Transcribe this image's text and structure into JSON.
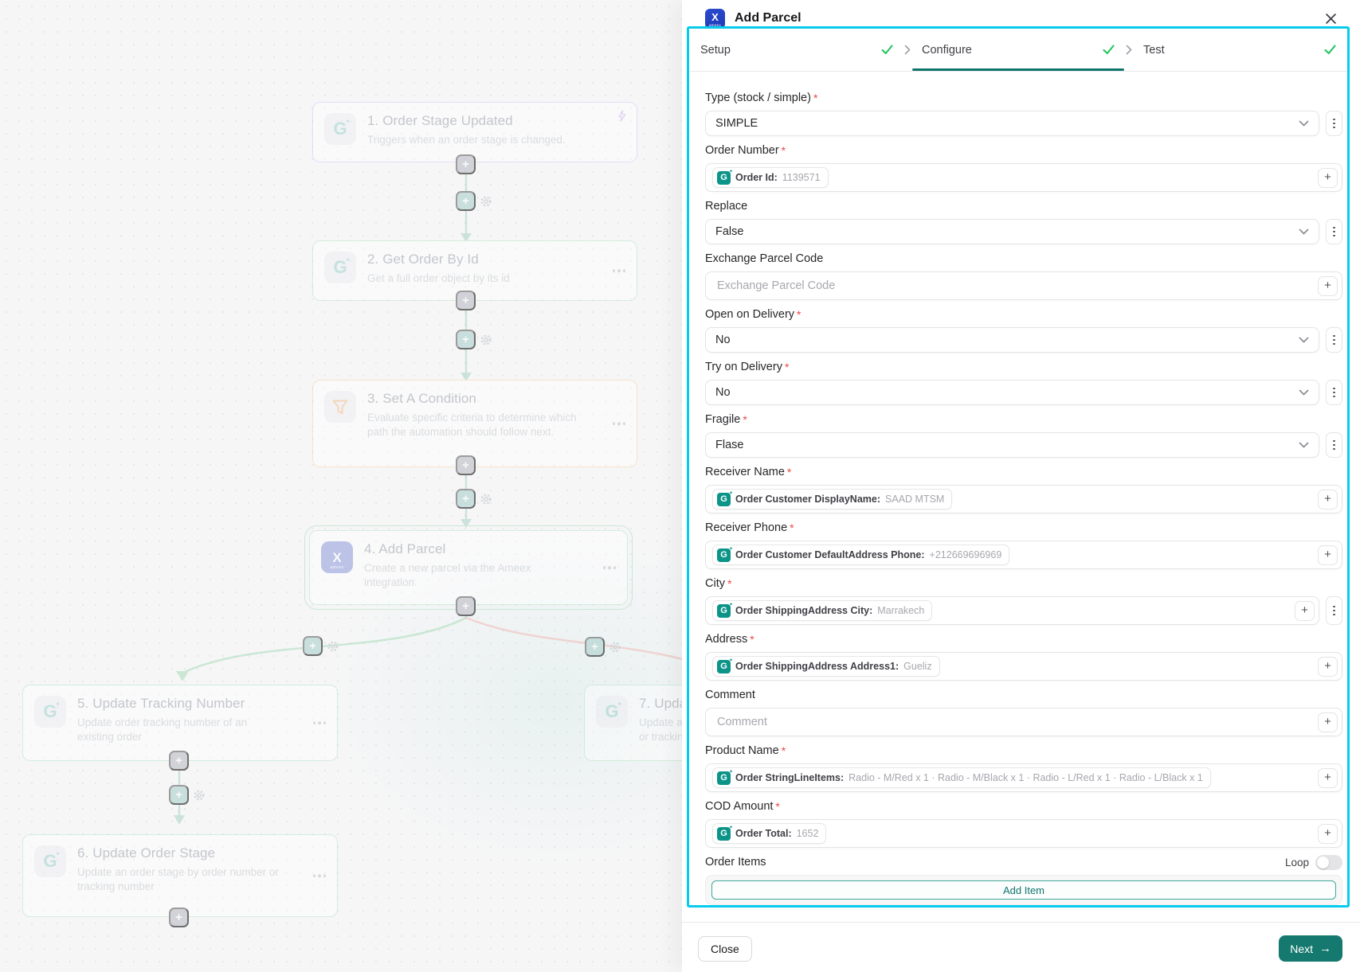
{
  "colors": {
    "accent_cyan": "#06cbec",
    "accent_teal": "#0f766e",
    "check_green": "#22c55e",
    "required_red": "#ef4444",
    "chip_teal": "#0d9488",
    "ameex_blue": "#2b4bd0"
  },
  "icons": {
    "plus": "+",
    "sparkle": "✦",
    "arrow_right": "→",
    "g_letter": "G",
    "ameex_letter": "X",
    "ameex_brand": "ameex"
  },
  "panel": {
    "title": "Add Parcel",
    "required_mark": "*",
    "steps": [
      {
        "label": "Setup"
      },
      {
        "label": "Configure"
      },
      {
        "label": "Test"
      }
    ],
    "fields": [
      {
        "label": "Type (stock / simple)",
        "kind": "select",
        "value": "SIMPLE"
      },
      {
        "label": "Order Number",
        "kind": "token",
        "token_label": "Order Id:",
        "token_value": "1139571"
      },
      {
        "label": "Replace",
        "kind": "select",
        "value": "False"
      },
      {
        "label": "Exchange Parcel Code",
        "kind": "input",
        "placeholder": "Exchange Parcel Code"
      },
      {
        "label": "Open on Delivery",
        "kind": "select",
        "value": "No"
      },
      {
        "label": "Try on Delivery",
        "kind": "select",
        "value": "No"
      },
      {
        "label": "Fragile",
        "kind": "select",
        "value": "Flase"
      },
      {
        "label": "Receiver Name",
        "kind": "token",
        "token_label": "Order Customer DisplayName:",
        "token_value": "SAAD MTSM"
      },
      {
        "label": "Receiver Phone",
        "kind": "token",
        "token_label": "Order Customer DefaultAddress Phone:",
        "token_value": "+212669696969"
      },
      {
        "label": "City",
        "kind": "token",
        "token_label": "Order ShippingAddress City:",
        "token_value": "Marrakech"
      },
      {
        "label": "Address",
        "kind": "token",
        "token_label": "Order ShippingAddress Address1:",
        "token_value": "Gueliz"
      },
      {
        "label": "Comment",
        "kind": "input",
        "placeholder": "Comment"
      },
      {
        "label": "Product Name",
        "kind": "token",
        "token_label": "Order StringLineItems:",
        "token_value": "Radio - M/Red x 1 · Radio - M/Black x 1 · Radio - L/Red x 1 · Radio - L/Black x 1"
      },
      {
        "label": "COD Amount",
        "kind": "token",
        "token_label": "Order Total:",
        "token_value": "1652"
      }
    ],
    "order_items": {
      "label": "Order Items",
      "loop_label": "Loop",
      "add_item_label": "Add Item"
    },
    "footer": {
      "close_label": "Close",
      "next_label": "Next"
    }
  },
  "canvas": {
    "steps": [
      {
        "title": "1. Order Stage Updated",
        "desc": "Triggers when an order stage is changed."
      },
      {
        "title": "2. Get Order By Id",
        "desc": "Get a full order object by its id"
      },
      {
        "title": "3. Set A Condition",
        "desc": "Evaluate specific criteria to determine which path the automation should follow next."
      },
      {
        "title": "4. Add Parcel",
        "desc": "Create a new parcel via the Ameex integration."
      },
      {
        "title": "5. Update Tracking Number",
        "desc": "Update order tracking number of an existing order"
      },
      {
        "title": "6. Update Order Stage",
        "desc": "Update an order stage by order number or tracking number"
      },
      {
        "title": "7. Upda",
        "desc": "Update a",
        "desc2": "or trackin"
      }
    ]
  }
}
